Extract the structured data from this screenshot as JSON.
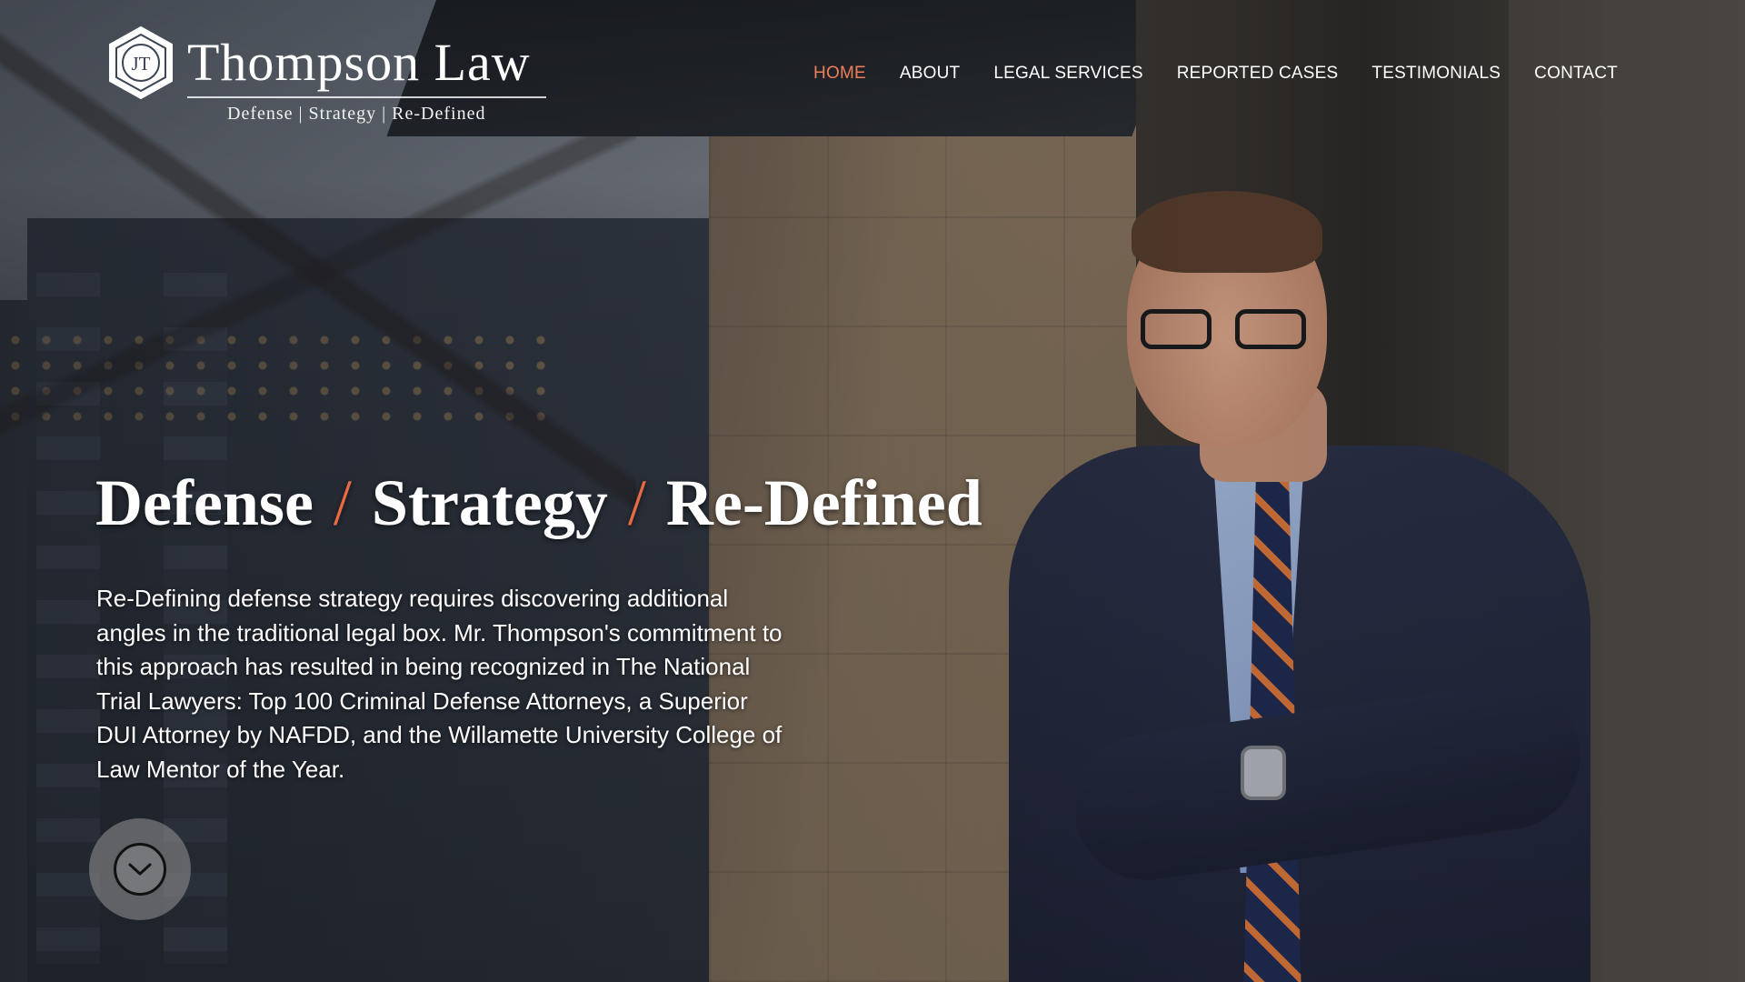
{
  "brand": {
    "badge_initials": "JT",
    "name": "Thompson Law",
    "tagline": "Defense | Strategy | Re-Defined"
  },
  "nav": {
    "items": [
      {
        "label": "HOME",
        "active": true
      },
      {
        "label": "ABOUT",
        "active": false
      },
      {
        "label": "LEGAL SERVICES",
        "active": false
      },
      {
        "label": "REPORTED CASES",
        "active": false
      },
      {
        "label": "TESTIMONIALS",
        "active": false
      },
      {
        "label": "CONTACT",
        "active": false
      }
    ]
  },
  "hero": {
    "headline_parts": [
      "Defense",
      "/",
      "Strategy",
      "/",
      "Re-Defined"
    ],
    "body": "Re-Defining defense strategy requires discovering additional angles in the traditional legal box. Mr. Thompson's commitment to this approach has resulted in being recognized in The National Trial Lawyers: Top 100 Criminal Defense Attorneys, a Superior DUI Attorney by NAFDD, and the Willamette University College of Law Mentor of the Year.",
    "scroll_icon": "chevron-down-icon"
  },
  "colors": {
    "accent": "#ef7f58",
    "text": "#ffffff"
  }
}
